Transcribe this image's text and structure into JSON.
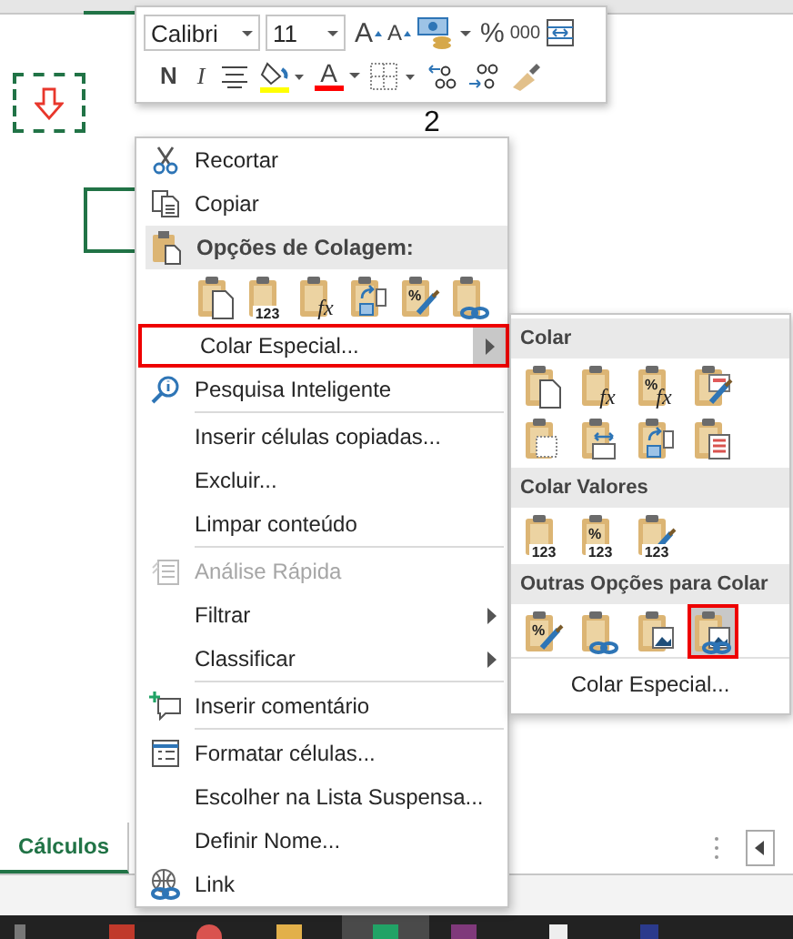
{
  "mini_toolbar": {
    "font": {
      "value": "Calibri"
    },
    "size": {
      "value": "11"
    },
    "row1": [
      {
        "kind": "grow",
        "label": "A"
      },
      {
        "kind": "shrink",
        "label": "A"
      },
      {
        "kind": "accounting"
      },
      {
        "kind": "percent",
        "label": "%"
      },
      {
        "kind": "thousands",
        "label": "000"
      },
      {
        "kind": "wrap"
      }
    ],
    "row2": [
      {
        "kind": "bold",
        "label": "N"
      },
      {
        "kind": "italic",
        "label": "I"
      },
      {
        "kind": "align"
      },
      {
        "kind": "fill",
        "color": "#ffff00"
      },
      {
        "kind": "font_color",
        "label": "A",
        "color": "#ff0000"
      },
      {
        "kind": "borders"
      },
      {
        "kind": "inc_decimal"
      },
      {
        "kind": "dec_decimal"
      },
      {
        "kind": "painter"
      }
    ]
  },
  "sheet": {
    "cell_value": "2"
  },
  "context_menu": {
    "items": [
      {
        "kind": "cut",
        "label": "Recortar",
        "disabled": false,
        "selected": false
      },
      {
        "kind": "copy",
        "label": "Copiar",
        "disabled": false,
        "selected": false
      },
      {
        "kind": "header",
        "label": "Opções de Colagem:"
      },
      {
        "kind": "paste_options",
        "options": [
          {
            "kind": "all",
            "selected": false
          },
          {
            "kind": "values",
            "texts": [
              "123"
            ],
            "selected": false
          },
          {
            "kind": "formulas",
            "texts": [
              "fx"
            ],
            "selected": false
          },
          {
            "kind": "transpose",
            "selected": false
          },
          {
            "kind": "formatting",
            "texts": [
              "%"
            ],
            "selected": false
          },
          {
            "kind": "link",
            "selected": false
          }
        ]
      },
      {
        "kind": "plain",
        "label": "Colar Especial...",
        "submenu": true,
        "disabled": false,
        "selected": true
      },
      {
        "kind": "smart_lookup",
        "label": "Pesquisa Inteligente",
        "disabled": false,
        "selected": false
      },
      {
        "kind": "separator"
      },
      {
        "kind": "plain",
        "label": "Inserir células copiadas...",
        "disabled": false,
        "selected": false
      },
      {
        "kind": "plain",
        "label": "Excluir...",
        "disabled": false,
        "selected": false
      },
      {
        "kind": "plain",
        "label": "Limpar conteúdo",
        "disabled": false,
        "selected": false
      },
      {
        "kind": "separator"
      },
      {
        "kind": "quick_analysis",
        "label": "Análise Rápida",
        "disabled": true,
        "selected": false
      },
      {
        "kind": "plain",
        "label": "Filtrar",
        "submenu": true,
        "disabled": false,
        "selected": false
      },
      {
        "kind": "plain",
        "label": "Classificar",
        "submenu": true,
        "disabled": false,
        "selected": false
      },
      {
        "kind": "separator"
      },
      {
        "kind": "comment",
        "label": "Inserir comentário",
        "disabled": false,
        "selected": false
      },
      {
        "kind": "separator"
      },
      {
        "kind": "format",
        "label": "Formatar células...",
        "disabled": false,
        "selected": false
      },
      {
        "kind": "plain",
        "label": "Escolher na Lista Suspensa...",
        "disabled": false,
        "selected": false
      },
      {
        "kind": "plain",
        "label": "Definir Nome...",
        "disabled": false,
        "selected": false
      },
      {
        "kind": "link",
        "label": "Link",
        "disabled": false,
        "selected": false
      }
    ]
  },
  "paste_special_menu": {
    "sections": [
      {
        "title": "Colar",
        "rows": [
          [
            {
              "kind": "all",
              "selected": false
            },
            {
              "kind": "formulas",
              "texts": [
                "fx"
              ],
              "selected": false
            },
            {
              "kind": "formulas_number",
              "texts": [
                "%",
                "fx"
              ],
              "selected": false
            },
            {
              "kind": "keep_source",
              "selected": false
            }
          ],
          [
            {
              "kind": "no_borders",
              "selected": false
            },
            {
              "kind": "keep_widths",
              "selected": false
            },
            {
              "kind": "transpose",
              "selected": false
            },
            {
              "kind": "conditional",
              "selected": false
            }
          ]
        ]
      },
      {
        "title": "Colar Valores",
        "rows": [
          [
            {
              "kind": "values",
              "texts": [
                "123"
              ],
              "selected": false
            },
            {
              "kind": "values_number",
              "texts": [
                "%",
                "123"
              ],
              "selected": false
            },
            {
              "kind": "values_source",
              "texts": [
                "123"
              ],
              "selected": false
            }
          ]
        ]
      },
      {
        "title": "Outras Opções para Colar",
        "rows": [
          [
            {
              "kind": "formatting",
              "texts": [
                "%"
              ],
              "selected": false
            },
            {
              "kind": "link",
              "selected": false
            },
            {
              "kind": "picture",
              "selected": false
            },
            {
              "kind": "linked_picture",
              "selected": true
            }
          ]
        ]
      }
    ],
    "footer": "Colar Especial..."
  },
  "sheet_tabs": [
    {
      "label": "Cálculos",
      "selected": true
    }
  ]
}
